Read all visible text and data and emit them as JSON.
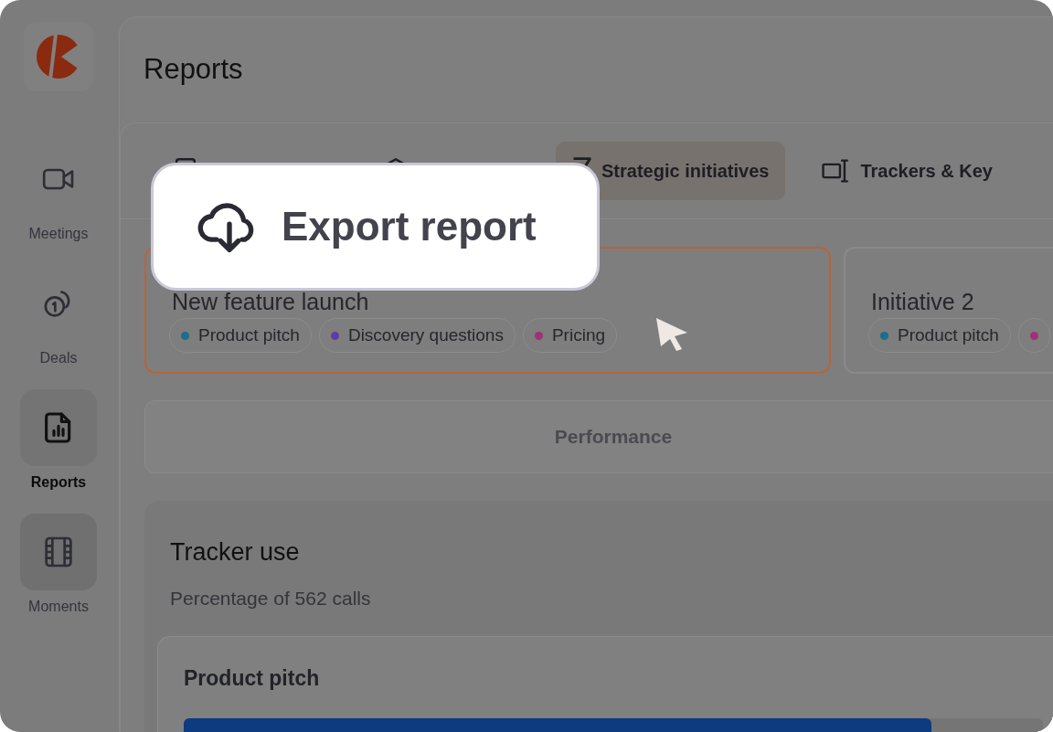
{
  "sidebar": {
    "items": [
      {
        "kind": "logo"
      },
      {
        "kind": "video",
        "label": "Meetings",
        "selected": false
      },
      {
        "kind": "deals",
        "label": "Deals",
        "selected": false
      },
      {
        "kind": "report",
        "label": "Reports",
        "selected": true
      },
      {
        "kind": "film",
        "label": "Moments",
        "selected": false,
        "highlighted": true
      }
    ]
  },
  "header": {
    "title": "Reports"
  },
  "tabs": [
    {
      "kind": "doc",
      "selected": false
    },
    {
      "kind": "box",
      "selected": false
    },
    {
      "kind": "flag",
      "label": "Strategic initiatives",
      "selected": true
    },
    {
      "kind": "tracker",
      "label": "Trackers & Key",
      "selected": false
    }
  ],
  "initiatives": [
    {
      "title": "New feature launch",
      "selected": true,
      "tags": [
        {
          "label": "Product pitch",
          "color": "#1a6e8e"
        },
        {
          "label": "Discovery questions",
          "color": "#5b3fa0"
        },
        {
          "label": "Pricing",
          "color": "#a03078"
        }
      ]
    },
    {
      "title": "Initiative 2",
      "selected": false,
      "tags": [
        {
          "label": "Product pitch",
          "color": "#1a6e8e"
        },
        {
          "color": "#a03078"
        }
      ]
    }
  ],
  "performance_button": "Performance",
  "tracker_use": {
    "title": "Tracker use",
    "subtitle": "Percentage of 562 calls",
    "trackers": [
      {
        "name": "Product pitch",
        "level": 0.87
      }
    ]
  },
  "callout": {
    "label": "Export report"
  }
}
